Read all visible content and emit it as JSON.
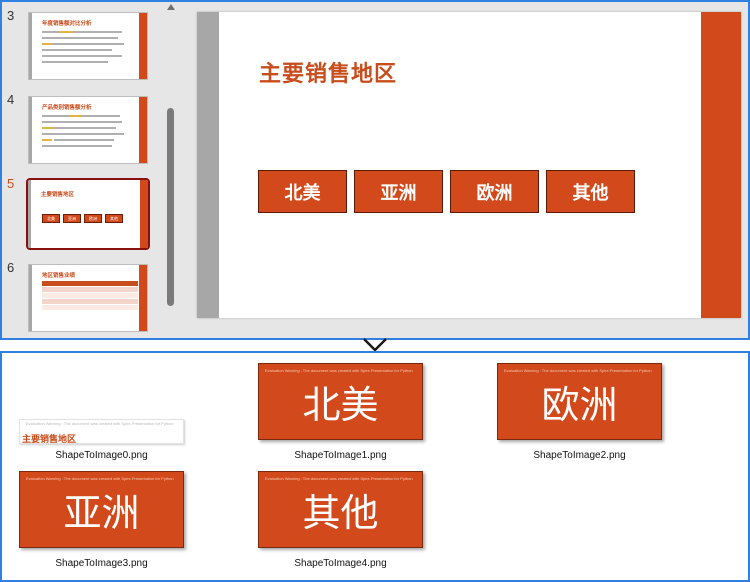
{
  "thumbnails": [
    {
      "number": "3",
      "title": "年度销售额对比分析",
      "kind": "text"
    },
    {
      "number": "4",
      "title": "产品类别销售额分析",
      "kind": "text"
    },
    {
      "number": "5",
      "title": "主要销售地区",
      "kind": "regions",
      "active": true,
      "boxes": [
        "北美",
        "亚洲",
        "欧洲",
        "其他"
      ]
    },
    {
      "number": "6",
      "title": "地区销售业绩",
      "kind": "table"
    }
  ],
  "slide": {
    "title": "主要销售地区",
    "regions": [
      "北美",
      "亚洲",
      "欧洲",
      "其他"
    ]
  },
  "files": [
    {
      "name": "ShapeToImage0.png",
      "text": "主要销售地区",
      "watermark": "Evaluation Warning : The document was created with Spire.Presentation for Python"
    },
    {
      "name": "ShapeToImage1.png",
      "text": "北美",
      "watermark": "Evaluation Warning : The document was created with Spire.Presentation for Python"
    },
    {
      "name": "ShapeToImage2.png",
      "text": "欧洲",
      "watermark": "Evaluation Warning : The document was created with Spire.Presentation for Python"
    },
    {
      "name": "ShapeToImage3.png",
      "text": "亚洲",
      "watermark": "Evaluation Warning : The document was created with Spire.Presentation for Python"
    },
    {
      "name": "ShapeToImage4.png",
      "text": "其他",
      "watermark": "Evaluation Warning : The document was created with Spire.Presentation for Python"
    }
  ],
  "colors": {
    "accent": "#d24a1b",
    "title": "#c84d1c",
    "frame": "#2f80e0",
    "gray": "#a7a7a7"
  }
}
